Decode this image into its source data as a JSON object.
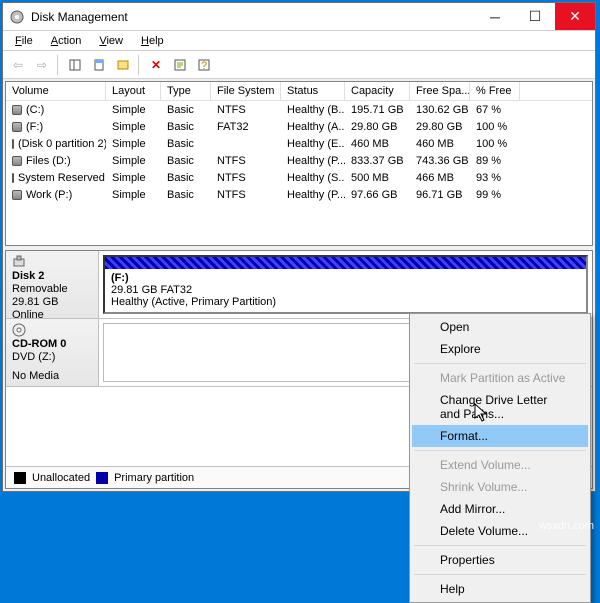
{
  "title": "Disk Management",
  "menu": {
    "file": "File",
    "action": "Action",
    "view": "View",
    "help": "Help"
  },
  "columns": {
    "vol": "Volume",
    "lay": "Layout",
    "typ": "Type",
    "fs": "File System",
    "sts": "Status",
    "cap": "Capacity",
    "fre": "Free Spa...",
    "pct": "% Free"
  },
  "volumes": [
    {
      "name": "(C:)",
      "layout": "Simple",
      "type": "Basic",
      "fs": "NTFS",
      "status": "Healthy (B...",
      "capacity": "195.71 GB",
      "free": "130.62 GB",
      "pct": "67 %"
    },
    {
      "name": "(F:)",
      "layout": "Simple",
      "type": "Basic",
      "fs": "FAT32",
      "status": "Healthy (A...",
      "capacity": "29.80 GB",
      "free": "29.80 GB",
      "pct": "100 %"
    },
    {
      "name": "(Disk 0 partition 2)",
      "layout": "Simple",
      "type": "Basic",
      "fs": "",
      "status": "Healthy (E...",
      "capacity": "460 MB",
      "free": "460 MB",
      "pct": "100 %"
    },
    {
      "name": "Files (D:)",
      "layout": "Simple",
      "type": "Basic",
      "fs": "NTFS",
      "status": "Healthy (P...",
      "capacity": "833.37 GB",
      "free": "743.36 GB",
      "pct": "89 %"
    },
    {
      "name": "System Reserved",
      "layout": "Simple",
      "type": "Basic",
      "fs": "NTFS",
      "status": "Healthy (S...",
      "capacity": "500 MB",
      "free": "466 MB",
      "pct": "93 %"
    },
    {
      "name": "Work (P:)",
      "layout": "Simple",
      "type": "Basic",
      "fs": "NTFS",
      "status": "Healthy (P...",
      "capacity": "97.66 GB",
      "free": "96.71 GB",
      "pct": "99 %"
    }
  ],
  "disk2": {
    "name": "Disk 2",
    "kind": "Removable",
    "size": "29.81 GB",
    "status": "Online",
    "part": {
      "title": "(F:)",
      "detail1": "29.81 GB FAT32",
      "detail2": "Healthy (Active, Primary Partition)"
    }
  },
  "cdrom": {
    "name": "CD-ROM 0",
    "kind": "DVD (Z:)",
    "status": "No Media"
  },
  "legend": {
    "un": "Unallocated",
    "pp": "Primary partition"
  },
  "ctx": {
    "open": "Open",
    "explore": "Explore",
    "mark": "Mark Partition as Active",
    "change": "Change Drive Letter and Paths...",
    "format": "Format...",
    "extend": "Extend Volume...",
    "shrink": "Shrink Volume...",
    "mirror": "Add Mirror...",
    "delete": "Delete Volume...",
    "props": "Properties",
    "help": "Help"
  },
  "watermark": "wsxdn.com"
}
